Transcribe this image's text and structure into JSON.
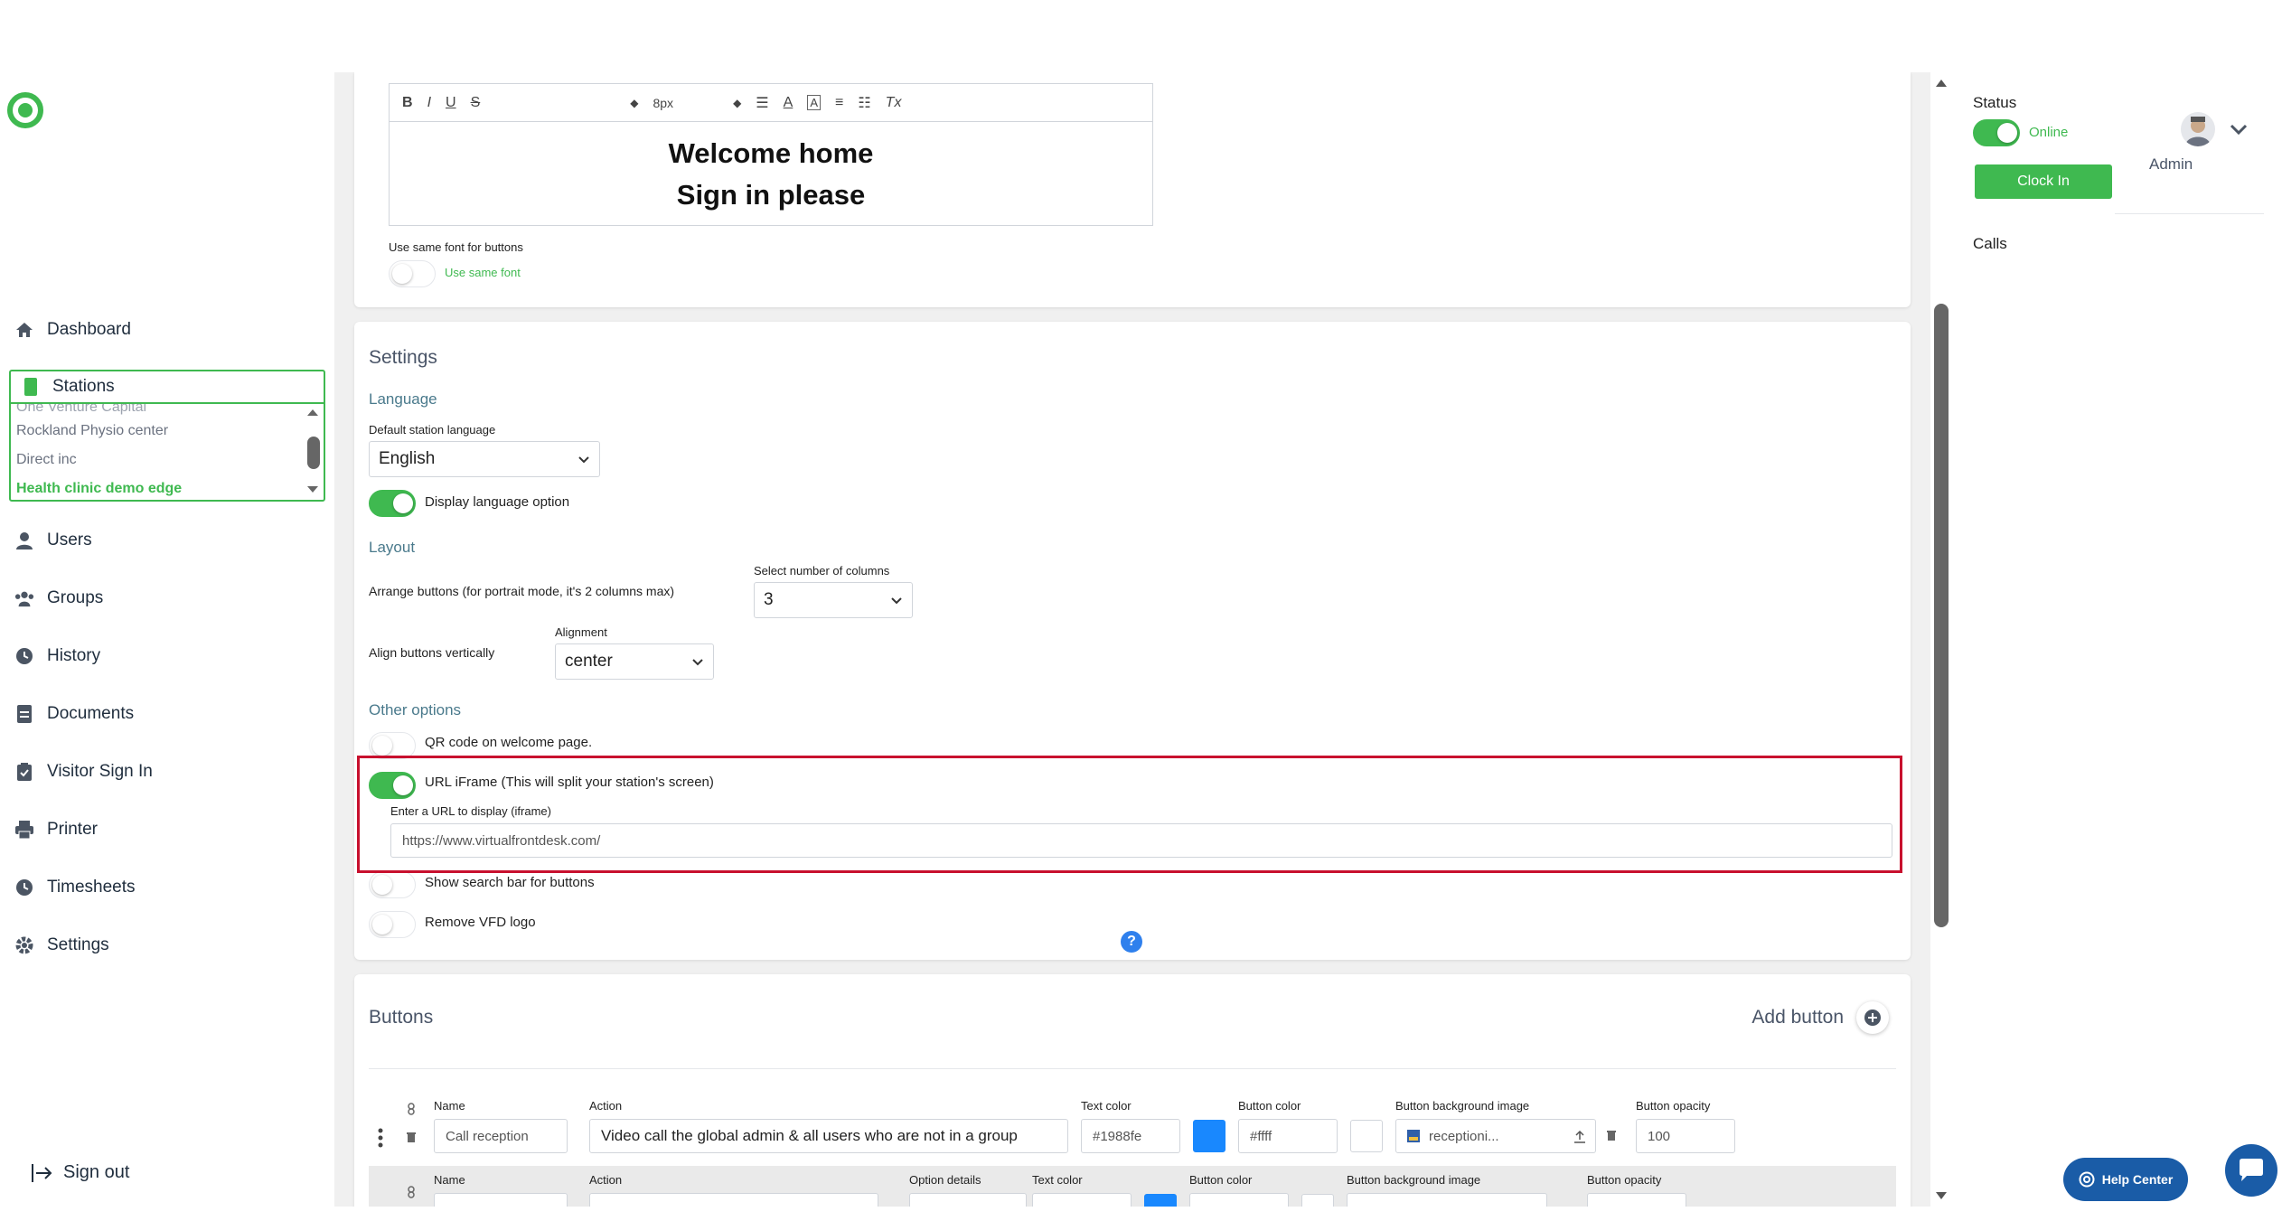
{
  "sidebar": {
    "nav": {
      "dashboard": "Dashboard",
      "stations": "Stations",
      "users": "Users",
      "groups": "Groups",
      "history": "History",
      "documents": "Documents",
      "visitor_sign_in": "Visitor Sign In",
      "printer": "Printer",
      "timesheets": "Timesheets",
      "settings": "Settings"
    },
    "stations_list": {
      "cut_item": "One Venture Capital",
      "items": [
        "Rockland Physio center",
        "Direct inc",
        "Health clinic demo edge"
      ],
      "active_index": 2
    },
    "sign_out": "Sign out"
  },
  "editor": {
    "toolbar": {
      "bold": "B",
      "italic": "I",
      "underline": "U",
      "strike": "S",
      "font_size": "8px",
      "text_color": "A",
      "clear": "Tx"
    },
    "line1": "Welcome home",
    "line2": "Sign in please",
    "use_same_font_heading": "Use same font for buttons",
    "use_same_font_toggle": "Use same font"
  },
  "settings": {
    "title": "Settings",
    "language": {
      "title": "Language",
      "default_label": "Default station language",
      "default_value": "English",
      "display_option": "Display language option"
    },
    "layout": {
      "title": "Layout",
      "arrange_label": "Arrange buttons (for portrait mode, it's 2 columns max)",
      "columns_label": "Select number of columns",
      "columns_value": "3",
      "align_label": "Align buttons vertically",
      "alignment_label": "Alignment",
      "alignment_value": "center"
    },
    "other": {
      "title": "Other options",
      "qr_code": "QR code on welcome page.",
      "url_iframe": "URL iFrame (This will split your station's screen)",
      "url_label": "Enter a URL to display (iframe)",
      "url_value": "https://www.virtualfrontdesk.com/",
      "search_bar": "Show search bar for buttons",
      "remove_logo": "Remove VFD logo"
    },
    "help_mark": "?"
  },
  "buttons": {
    "title": "Buttons",
    "add_button": "Add button",
    "row1": {
      "name_label": "Name",
      "name_value": "Call reception",
      "action_label": "Action",
      "action_value": "Video call the global admin & all users who are not in a group",
      "text_color_label": "Text color",
      "text_color_value": "#1988fe",
      "text_color_hex": "#1988fe",
      "button_color_label": "Button color",
      "button_color_value": "#ffff",
      "bg_image_label": "Button background image",
      "bg_image_value": "receptioni...",
      "opacity_label": "Button opacity",
      "opacity_value": "100"
    },
    "row2": {
      "name_label": "Name",
      "action_label": "Action",
      "option_label": "Option details",
      "text_color_label": "Text color",
      "button_color_label": "Button color",
      "bg_image_label": "Button background image",
      "opacity_label": "Button opacity"
    }
  },
  "right_panel": {
    "status_label": "Status",
    "status_value": "Online",
    "clock_in": "Clock In",
    "user": "Admin",
    "calls": "Calls"
  },
  "help_center": "Help Center",
  "colors": {
    "accent_green": "#3fb950",
    "highlight_red": "#c8102e",
    "help_blue": "#1a5ca7",
    "swatch_blue": "#1988fe"
  }
}
